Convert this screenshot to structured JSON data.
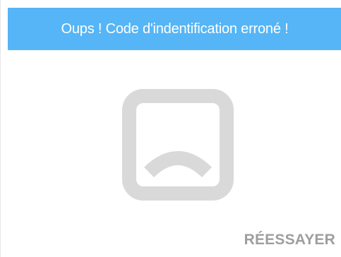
{
  "dialog": {
    "title": "Oups ! Code d'indentification erroné !",
    "retry_label": "RÉESSAYER",
    "icon": "sad-face-icon"
  },
  "colors": {
    "header_background": "#55b5f6",
    "header_text": "#ffffff",
    "icon": "#d9d9d9",
    "button_text": "#9e9e9e",
    "background": "#ffffff"
  }
}
